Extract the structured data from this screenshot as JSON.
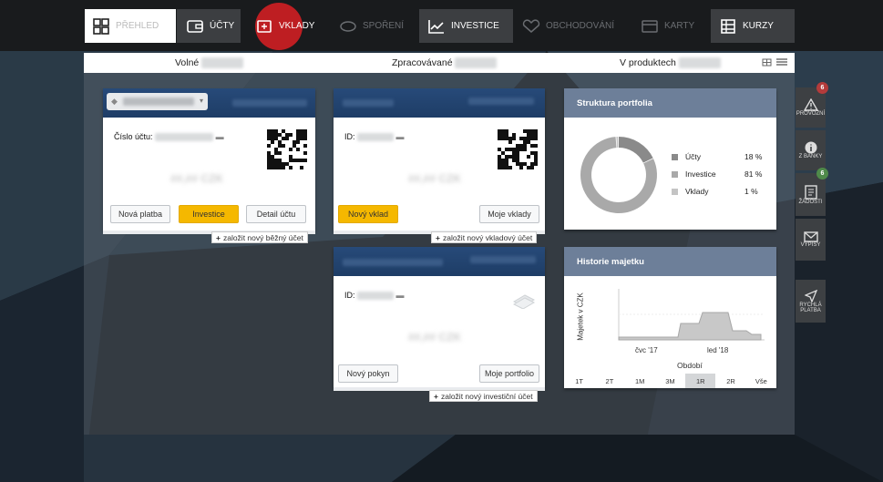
{
  "nav": {
    "items": [
      {
        "key": "prehled",
        "label": "PŘEHLED",
        "icon": "grid-icon"
      },
      {
        "key": "ucty",
        "label": "ÚČTY",
        "icon": "wallet-icon"
      },
      {
        "key": "vklady",
        "label": "VKLADY",
        "icon": "deposit-icon"
      },
      {
        "key": "sporeni",
        "label": "SPOŘENÍ",
        "icon": "piggy-bank-icon"
      },
      {
        "key": "investice",
        "label": "INVESTICE",
        "icon": "chart-line-icon"
      },
      {
        "key": "obchodovani",
        "label": "OBCHODOVÁNÍ",
        "icon": "handshake-icon"
      },
      {
        "key": "karty",
        "label": "KARTY",
        "icon": "card-icon"
      },
      {
        "key": "kurzy",
        "label": "KURZY",
        "icon": "table-icon"
      }
    ]
  },
  "stats": {
    "volne": "Volné",
    "zpracovavane": "Zpracovávané",
    "v_produktech": "V produktech"
  },
  "account_card": {
    "number_label": "Číslo účtu:",
    "amount": "##,## CZK",
    "buttons": {
      "new_payment": "Nová platba",
      "invest": "Investice",
      "detail": "Detail účtu"
    },
    "add_link": "založit nový běžný účet"
  },
  "deposit_card": {
    "id_label": "ID:",
    "amount": "##,## CZK",
    "buttons": {
      "new_deposit": "Nový vklad",
      "my_deposits": "Moje vklady"
    },
    "add_link": "založit nový vkladový účet"
  },
  "investment_card": {
    "id_label": "ID:",
    "amount": "##,## CZK",
    "buttons": {
      "new_order": "Nový pokyn",
      "my_portfolio": "Moje portfolio"
    },
    "add_link": "založit nový investiční účet"
  },
  "portfolio": {
    "title": "Struktura portfolia",
    "legend": [
      {
        "label": "Účty",
        "value": "18 %",
        "color": "#8a8a8a"
      },
      {
        "label": "Investice",
        "value": "81 %",
        "color": "#a9a9a9"
      },
      {
        "label": "Vklady",
        "value": "1 %",
        "color": "#c4c4c4"
      }
    ]
  },
  "history": {
    "title": "Historie majetku",
    "ylabel": "Majetek v CZK",
    "xlabel": "Období",
    "xticks": [
      "čvc '17",
      "led '18"
    ],
    "ranges": [
      "1T",
      "2T",
      "1M",
      "3M",
      "1R",
      "2R",
      "Vše"
    ],
    "active_range": "1R"
  },
  "sidebar": {
    "provozni": {
      "label": "PROVOZNÍ",
      "badge": "6"
    },
    "z_banky": {
      "label": "Z BANKY"
    },
    "zadosti": {
      "label": "ŽÁDOSTI",
      "badge": "6"
    },
    "vypisy": {
      "label": "VÝPISY"
    },
    "rychla_platba": {
      "label": "RYCHLÁ PLATBA"
    }
  }
}
